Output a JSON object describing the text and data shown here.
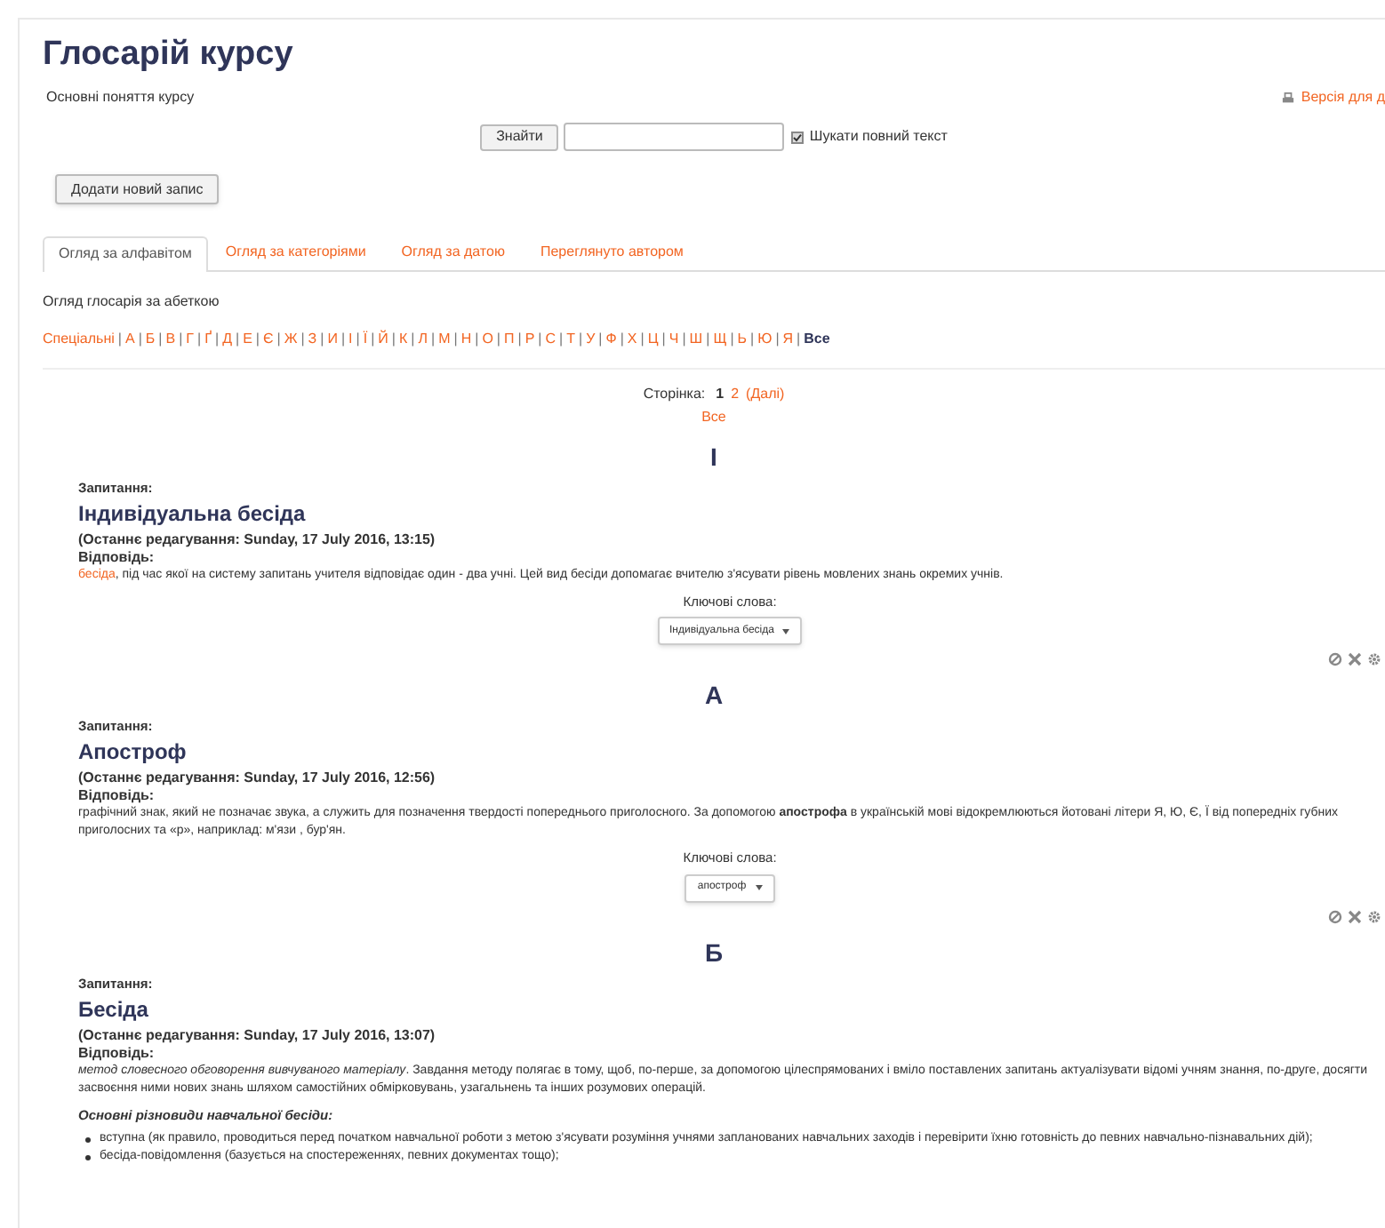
{
  "page_title": "Глосарій курсу",
  "subtitle": "Основні поняття курсу",
  "print_link": "Версія для д",
  "search": {
    "button": "Знайти",
    "fulltext_label": "Шукати повний текст",
    "fulltext_checked": true
  },
  "add_button": "Додати новий запис",
  "tabs": [
    {
      "label": "Огляд за алфавітом",
      "selected": true
    },
    {
      "label": "Огляд за категоріями",
      "selected": false
    },
    {
      "label": "Огляд за датою",
      "selected": false
    },
    {
      "label": "Переглянуто автором",
      "selected": false
    }
  ],
  "browse_caption": "Огляд глосарія за абеткою",
  "letter_separator": "|",
  "letters": [
    {
      "label": "Спеціальні",
      "selected": false
    },
    {
      "label": "А",
      "selected": false
    },
    {
      "label": "Б",
      "selected": false
    },
    {
      "label": "В",
      "selected": false
    },
    {
      "label": "Г",
      "selected": false
    },
    {
      "label": "Ґ",
      "selected": false
    },
    {
      "label": "Д",
      "selected": false
    },
    {
      "label": "Е",
      "selected": false
    },
    {
      "label": "Є",
      "selected": false
    },
    {
      "label": "Ж",
      "selected": false
    },
    {
      "label": "З",
      "selected": false
    },
    {
      "label": "И",
      "selected": false
    },
    {
      "label": "І",
      "selected": false
    },
    {
      "label": "Ї",
      "selected": false
    },
    {
      "label": "Й",
      "selected": false
    },
    {
      "label": "К",
      "selected": false
    },
    {
      "label": "Л",
      "selected": false
    },
    {
      "label": "М",
      "selected": false
    },
    {
      "label": "Н",
      "selected": false
    },
    {
      "label": "О",
      "selected": false
    },
    {
      "label": "П",
      "selected": false
    },
    {
      "label": "Р",
      "selected": false
    },
    {
      "label": "С",
      "selected": false
    },
    {
      "label": "Т",
      "selected": false
    },
    {
      "label": "У",
      "selected": false
    },
    {
      "label": "Ф",
      "selected": false
    },
    {
      "label": "Х",
      "selected": false
    },
    {
      "label": "Ц",
      "selected": false
    },
    {
      "label": "Ч",
      "selected": false
    },
    {
      "label": "Ш",
      "selected": false
    },
    {
      "label": "Щ",
      "selected": false
    },
    {
      "label": "Ь",
      "selected": false
    },
    {
      "label": "Ю",
      "selected": false
    },
    {
      "label": "Я",
      "selected": false
    },
    {
      "label": "Все",
      "selected": true
    }
  ],
  "pagination": {
    "label": "Сторінка:",
    "pages": [
      {
        "label": "1",
        "selected": true
      },
      {
        "label": "2",
        "selected": false
      }
    ],
    "next": "(Далі)",
    "all": "Все"
  },
  "entries": [
    {
      "letter": "І",
      "question_label": "Запитання:",
      "concept": "Індивідуальна бесіда",
      "edited": "(Останнє редагування: Sunday, 17 July 2016, 13:15)",
      "answer_label": "Відповідь:",
      "answer": [
        {
          "link": "бесіда",
          "text": ", під час якої на систему запитань учителя відповідає один - два учні. Цей вид бесіди допомагає вчителю з'ясувати рівень мовлених знань окремих учнів."
        }
      ],
      "keywords_label": "Ключові слова:",
      "keyword": "Індивідуальна бесіда"
    },
    {
      "letter": "А",
      "question_label": "Запитання:",
      "concept": "Апостроф",
      "edited": "(Останнє редагування: Sunday, 17 July 2016, 12:56)",
      "answer_label": "Відповідь:",
      "answer": [
        {
          "text": "графічний знак, який не позначає звука, а служить для позначення твердості попереднього приголосного. За допомогою **апострофа** в українській мові відокремлюються йотовані літери Я, Ю, Є, Ї від попередніх губних приголосних та «р», наприклад: м'язи , бур'ян."
        }
      ],
      "keywords_label": "Ключові слова:",
      "keyword": "апостроф"
    },
    {
      "letter": "Б",
      "question_label": "Запитання:",
      "concept": "Бесіда",
      "edited": "(Останнє редагування: Sunday, 17 July 2016, 13:07)",
      "answer_label": "Відповідь:",
      "answer": [
        {
          "text": "*метод словесного обговорення вивчуваного матеріалу*. Завдання методу  полягає в тому, щоб, по-перше, за допомогою цілеспрямованих і вміло поставлених запитань актуалізувати відомі учням знання, по-друге, досягти засвоєння ними нових знань шляхом самостійних обмірковувань, узагальнень та інших розумових операцій."
        }
      ],
      "subheading": "Основні різновиди навчальної бесіди:",
      "list": [
        "вступна (як правило, проводиться перед початком навчальної роботи з метою з'ясувати розуміння учнями запланованих навчальних заходів і перевірити їхню готовність до певних навчально-пізнавальних дій);",
        "бесіда-повідомлення (базується на спостереженнях, певних документах тощо);"
      ]
    }
  ]
}
